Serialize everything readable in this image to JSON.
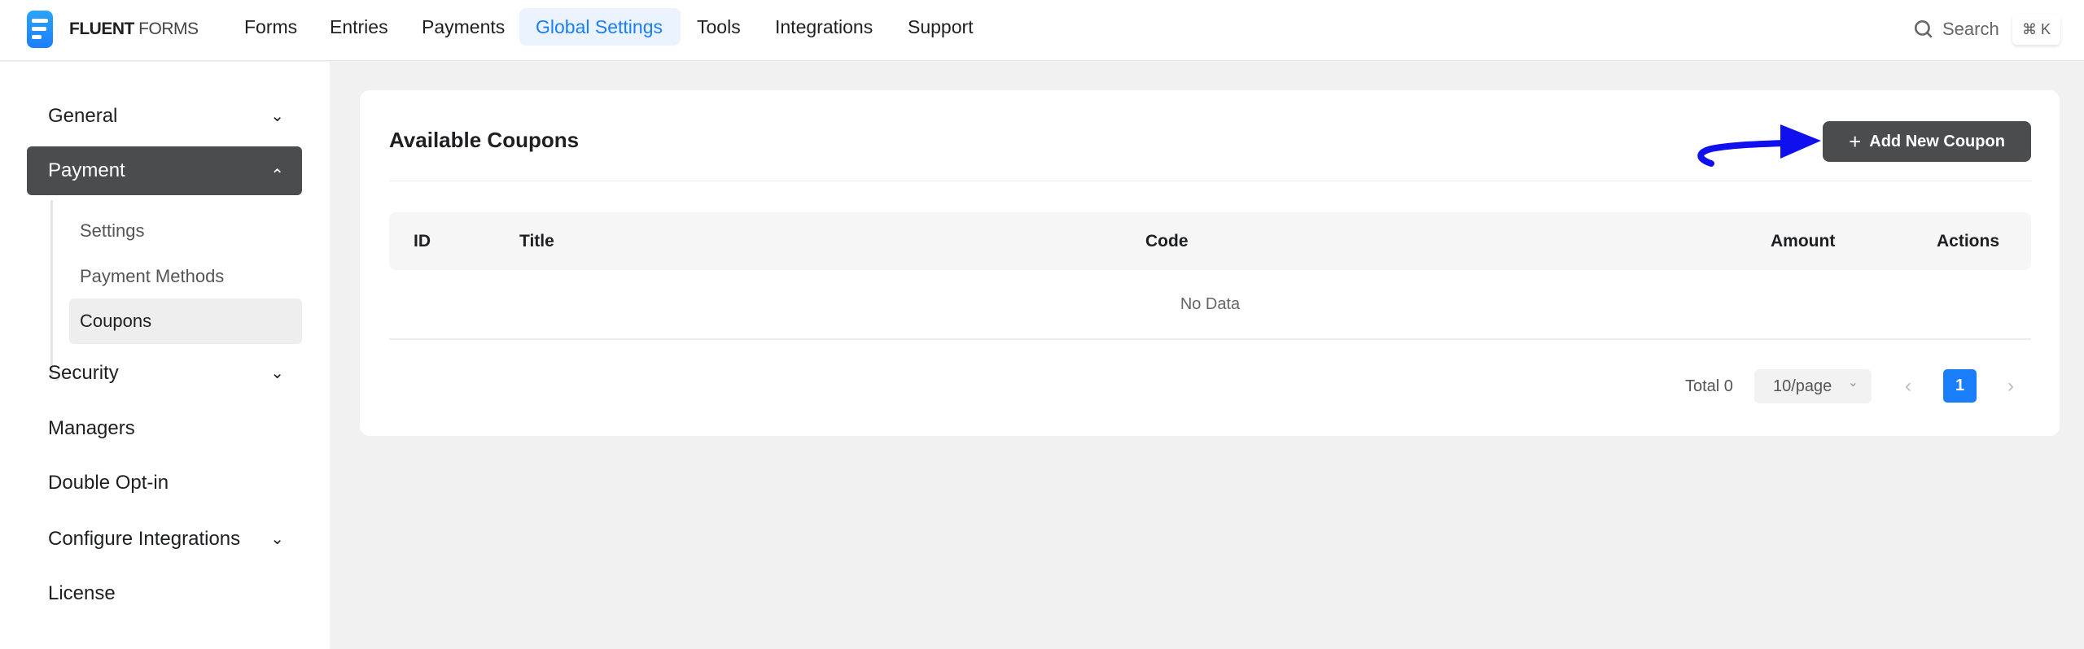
{
  "brand": {
    "name_bold": "FLUENT",
    "name_light": "FORMS"
  },
  "nav": [
    "Forms",
    "Entries",
    "Payments",
    "Global Settings",
    "Tools",
    "Integrations",
    "Support"
  ],
  "search": {
    "label": "Search",
    "shortcut": "⌘ K"
  },
  "sidebar": {
    "items": [
      {
        "label": "General",
        "chevron": "down"
      },
      {
        "label": "Payment",
        "chevron": "up"
      },
      {
        "label": "Security",
        "chevron": "down"
      },
      {
        "label": "Managers"
      },
      {
        "label": "Double Opt-in"
      },
      {
        "label": "Configure Integrations",
        "chevron": "down"
      },
      {
        "label": "License"
      }
    ],
    "payment_sub": [
      "Settings",
      "Payment Methods",
      "Coupons"
    ]
  },
  "main": {
    "title": "Available Coupons",
    "add_button": "Add New Coupon",
    "columns": [
      "ID",
      "Title",
      "Code",
      "Amount",
      "Actions"
    ],
    "empty_text": "No Data",
    "pagination": {
      "total": "Total 0",
      "page_size": "10/page",
      "current_page": "1"
    }
  },
  "colors": {
    "accent": "#1a7efb",
    "dark": "#4b4c4d",
    "annotation": "#1010ee"
  }
}
